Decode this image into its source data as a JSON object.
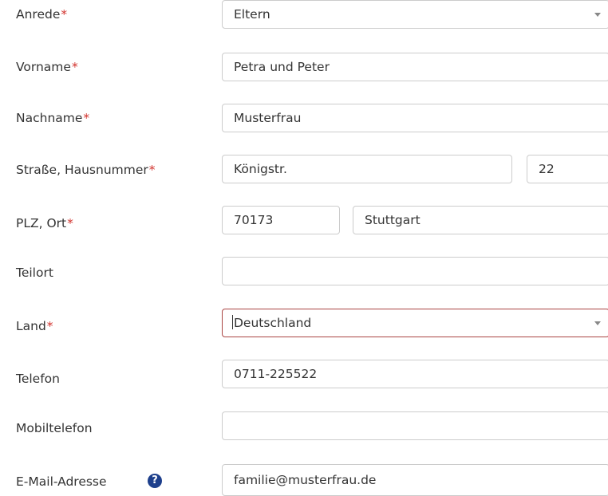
{
  "form": {
    "anrede": {
      "label": "Anrede",
      "required_mark": "*",
      "value": "Eltern"
    },
    "vorname": {
      "label": "Vorname",
      "required_mark": "*",
      "value": "Petra und Peter"
    },
    "nachname": {
      "label": "Nachname",
      "required_mark": "*",
      "value": "Musterfrau"
    },
    "strasse": {
      "label": "Straße, Hausnummer",
      "required_mark": "*",
      "street_value": "Königstr.",
      "number_value": "22"
    },
    "plz_ort": {
      "label": "PLZ, Ort",
      "required_mark": "*",
      "plz_value": "70173",
      "ort_value": "Stuttgart"
    },
    "teilort": {
      "label": "Teilort",
      "value": ""
    },
    "land": {
      "label": "Land",
      "required_mark": "*",
      "value": "Deutschland"
    },
    "telefon": {
      "label": "Telefon",
      "value": "0711-225522"
    },
    "mobiltelefon": {
      "label": "Mobiltelefon",
      "value": ""
    },
    "email": {
      "label": "E-Mail-Adresse",
      "help_icon": "?",
      "value": "familie@musterfrau.de"
    }
  },
  "colors": {
    "required_star": "#d2322d",
    "focused_border": "#a94442",
    "help_icon_bg": "#1d3f8c",
    "border": "#cccccc"
  },
  "icons": [
    "chevron-down-icon",
    "question-circle-icon"
  ]
}
